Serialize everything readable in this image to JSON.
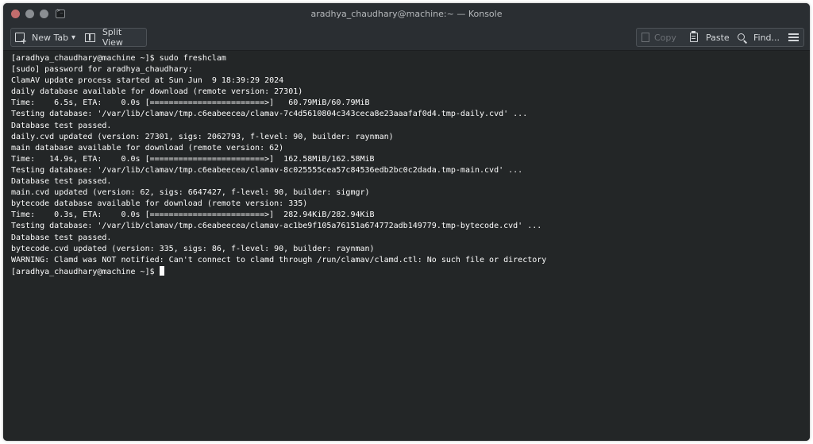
{
  "window": {
    "title": "aradhya_chaudhary@machine:~ — Konsole"
  },
  "toolbar": {
    "new_tab_label": "New Tab",
    "split_view_label": "Split View",
    "copy_label": "Copy",
    "paste_label": "Paste",
    "find_label": "Find..."
  },
  "icons": {
    "app": "terminal-icon",
    "new_tab": "new-tab-icon",
    "split_view": "split-view-icon",
    "copy": "copy-icon",
    "paste": "paste-icon",
    "find": "search-icon",
    "menu": "hamburger-menu-icon"
  },
  "colors": {
    "terminal_bg": "#232627",
    "terminal_fg": "#fcfcfc",
    "chrome_bg": "#2a2e32"
  },
  "terminal": {
    "lines": [
      "[aradhya_chaudhary@machine ~]$ sudo freshclam",
      "[sudo] password for aradhya_chaudhary:",
      "ClamAV update process started at Sun Jun  9 18:39:29 2024",
      "daily database available for download (remote version: 27301)",
      "Time:    6.5s, ETA:    0.0s [========================>]   60.79MiB/60.79MiB",
      "Testing database: '/var/lib/clamav/tmp.c6eabeecea/clamav-7c4d5610804c343ceca8e23aaafaf0d4.tmp-daily.cvd' ...",
      "Database test passed.",
      "daily.cvd updated (version: 27301, sigs: 2062793, f-level: 90, builder: raynman)",
      "main database available for download (remote version: 62)",
      "Time:   14.9s, ETA:    0.0s [========================>]  162.58MiB/162.58MiB",
      "Testing database: '/var/lib/clamav/tmp.c6eabeecea/clamav-8c025555cea57c84536edb2bc0c2dada.tmp-main.cvd' ...",
      "Database test passed.",
      "main.cvd updated (version: 62, sigs: 6647427, f-level: 90, builder: sigmgr)",
      "bytecode database available for download (remote version: 335)",
      "Time:    0.3s, ETA:    0.0s [========================>]  282.94KiB/282.94KiB",
      "Testing database: '/var/lib/clamav/tmp.c6eabeecea/clamav-ac1be9f105a76151a674772adb149779.tmp-bytecode.cvd' ...",
      "Database test passed.",
      "bytecode.cvd updated (version: 335, sigs: 86, f-level: 90, builder: raynman)",
      "WARNING: Clamd was NOT notified: Can't connect to clamd through /run/clamav/clamd.ctl: No such file or directory"
    ],
    "prompt": "[aradhya_chaudhary@machine ~]$ "
  }
}
